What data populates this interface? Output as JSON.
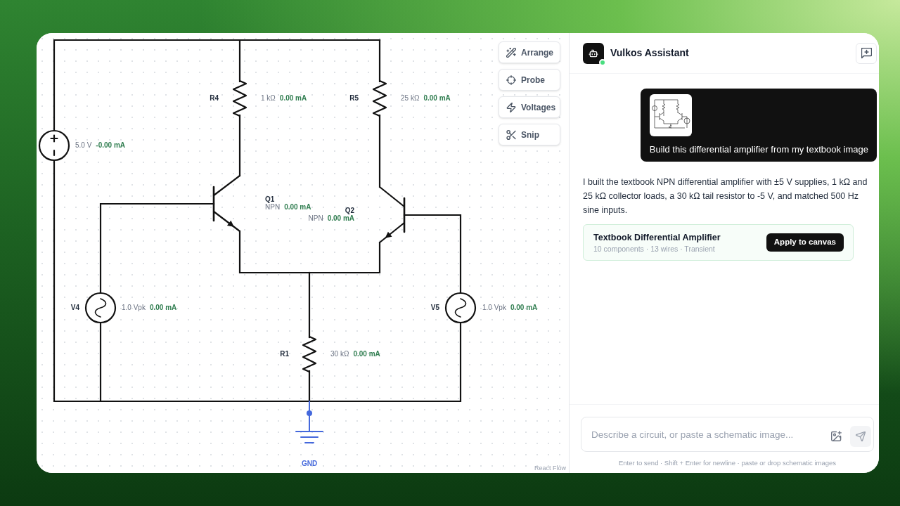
{
  "canvas": {
    "toolbar": [
      {
        "label": "Arrange"
      },
      {
        "label": "Probe"
      },
      {
        "label": "Voltages"
      },
      {
        "label": "Snip"
      }
    ],
    "components": [
      {
        "kind": "dc_source",
        "value": "5.0 V",
        "current": "-0.00 mA"
      },
      {
        "kind": "resistor",
        "name": "R4",
        "value": "1 kΩ",
        "current": "0.00 mA"
      },
      {
        "kind": "resistor",
        "name": "R5",
        "value": "25 kΩ",
        "current": "0.00 mA"
      },
      {
        "kind": "npn",
        "name": "Q1",
        "value": "NPN",
        "current": "0.00 mA"
      },
      {
        "kind": "npn",
        "name": "Q2",
        "value": "NPN",
        "current": "0.00 mA"
      },
      {
        "kind": "ac_source",
        "name": "V4",
        "value": "1.0 Vpk",
        "current": "0.00 mA"
      },
      {
        "kind": "ac_source",
        "name": "V5",
        "value": "1.0 Vpk",
        "current": "0.00 mA"
      },
      {
        "kind": "resistor",
        "name": "R1",
        "value": "30 kΩ",
        "current": "0.00 mA"
      },
      {
        "kind": "ground",
        "name": "GND"
      }
    ],
    "attribution": "React Flow"
  },
  "assistant": {
    "header": {
      "title": "Vulkos Assistant",
      "online": true
    },
    "messages": [
      {
        "kind": "user",
        "image_attached": true,
        "text": "Build this differential amplifier from my textbook image"
      },
      {
        "kind": "assistant",
        "text": "I built the textbook NPN differential amplifier with ±5 V supplies, 1 kΩ and 25 kΩ collector loads, a 30 kΩ tail resistor to -5 V, and matched 500 Hz sine inputs.",
        "result": {
          "title": "Textbook Differential Amplifier",
          "meta": "10 components · 13 wires · Transient",
          "button": "Apply to canvas"
        }
      }
    ],
    "composer": {
      "placeholder": "Describe a circuit, or paste a schematic image...",
      "send_disabled": true,
      "hint": "Enter to send · Shift + Enter for newline · paste or drop schematic images"
    }
  }
}
